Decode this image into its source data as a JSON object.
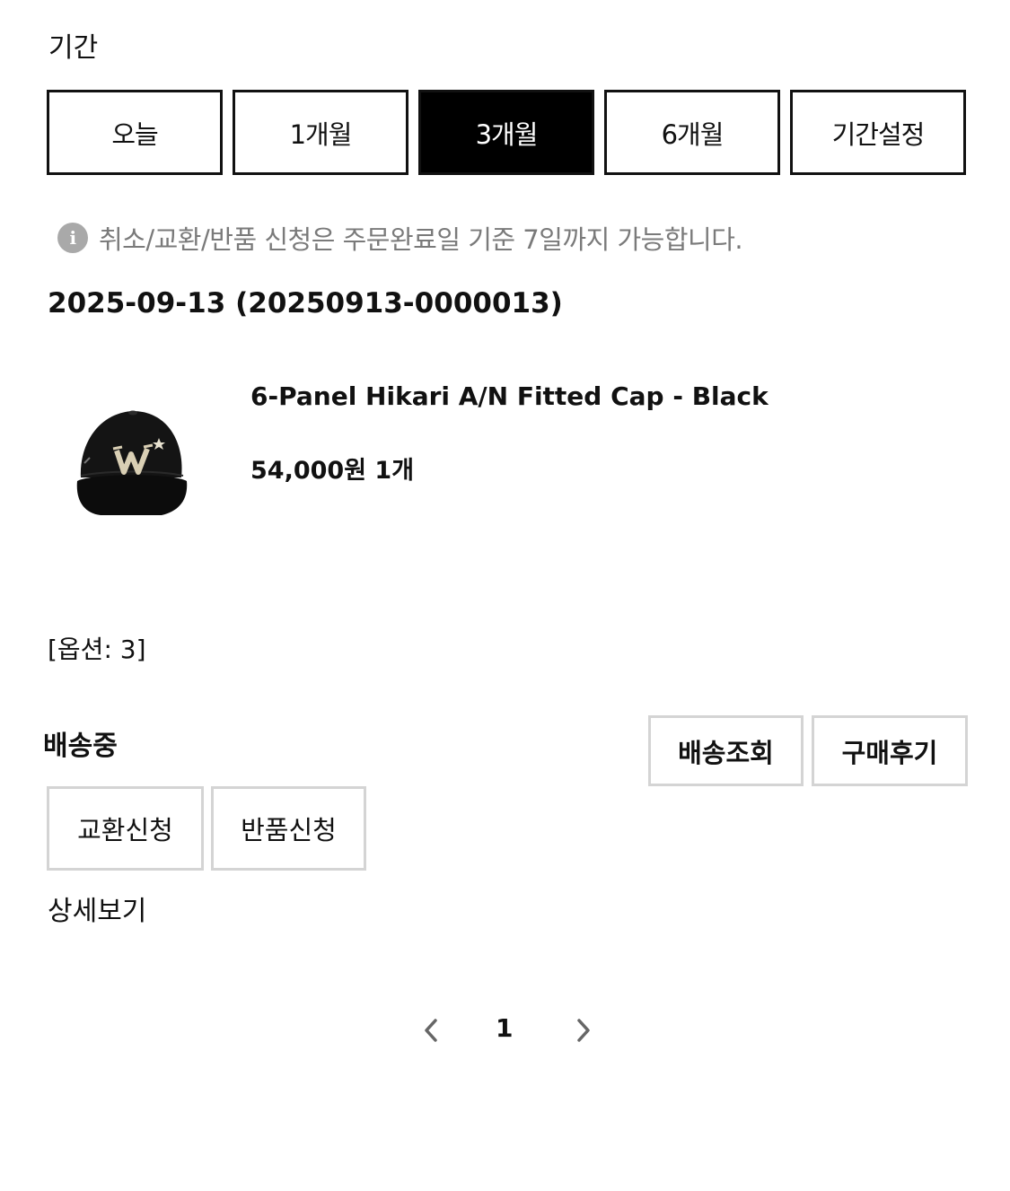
{
  "filter": {
    "label": "기간",
    "tabs": [
      {
        "label": "오늘",
        "active": false
      },
      {
        "label": "1개월",
        "active": false
      },
      {
        "label": "3개월",
        "active": true
      },
      {
        "label": "6개월",
        "active": false
      },
      {
        "label": "기간설정",
        "active": false
      }
    ]
  },
  "notice": {
    "icon": "info-icon",
    "icon_glyph": "i",
    "text": "취소/교환/반품 신청은 주문완료일 기준 7일까지 가능합니다."
  },
  "order": {
    "heading": "2025-09-13 (20250913-0000013)",
    "product": {
      "name": "6-Panel Hikari A/N Fitted Cap - Black",
      "price_qty": "54,000원 1개",
      "image": "black-cap-image"
    },
    "option": "[옵션: 3]",
    "status": "배송중",
    "actions": {
      "tracking": "배송조회",
      "review": "구매후기",
      "exchange": "교환신청",
      "return": "반품신청"
    },
    "detail_link": "상세보기"
  },
  "pagination": {
    "current_page": "1",
    "prev_icon": "chevron-left-icon",
    "next_icon": "chevron-right-icon"
  },
  "colors": {
    "active_tab_bg": "#000000",
    "notice_text": "#7a7a7a",
    "button_border": "#d4d4d4"
  }
}
